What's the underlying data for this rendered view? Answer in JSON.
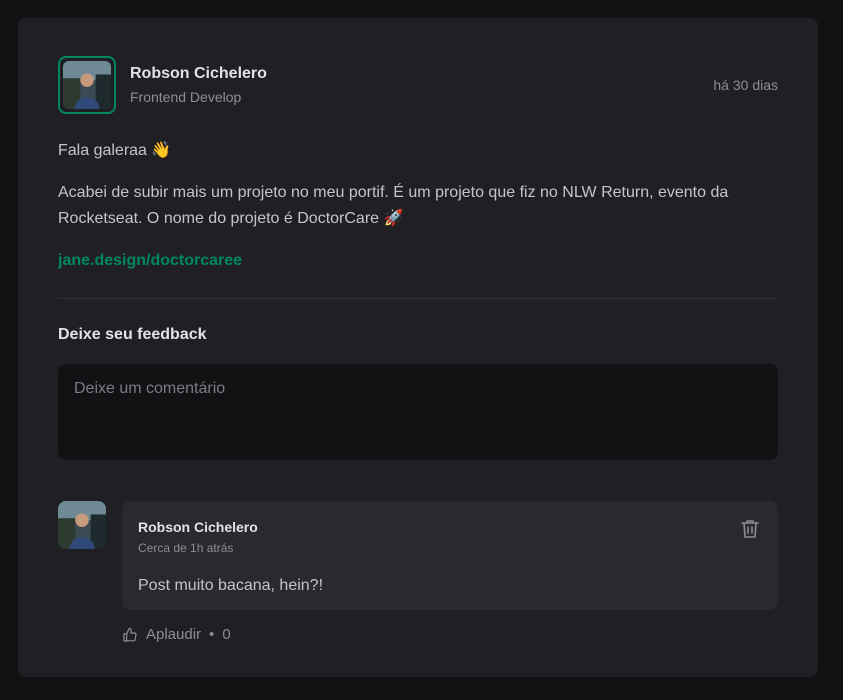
{
  "post": {
    "author_name": "Robson Cichelero",
    "author_role": "Frontend Develop",
    "published": "há 30 dias",
    "paragraph_1": "Fala galeraa 👋",
    "paragraph_2": "Acabei de subir mais um projeto no meu portif. É um projeto que fiz no NLW Return, evento da Rocketseat. O nome do projeto é DoctorCare 🚀",
    "link_text": "jane.design/doctorcaree"
  },
  "feedback": {
    "title": "Deixe seu feedback",
    "placeholder": "Deixe um comentário"
  },
  "comments": [
    {
      "author_name": "Robson Cichelero",
      "time": "Cerca de 1h atrás",
      "text": "Post muito bacana, hein?!",
      "applaud_label": "Aplaudir",
      "applaud_separator": "•",
      "applaud_count": "0"
    }
  ],
  "colors": {
    "accent": "#00875f",
    "card": "#202024",
    "background": "#121214",
    "comment_box": "#29292e"
  },
  "icons": {
    "delete": "trash-icon",
    "applaud": "thumbs-up-icon"
  }
}
